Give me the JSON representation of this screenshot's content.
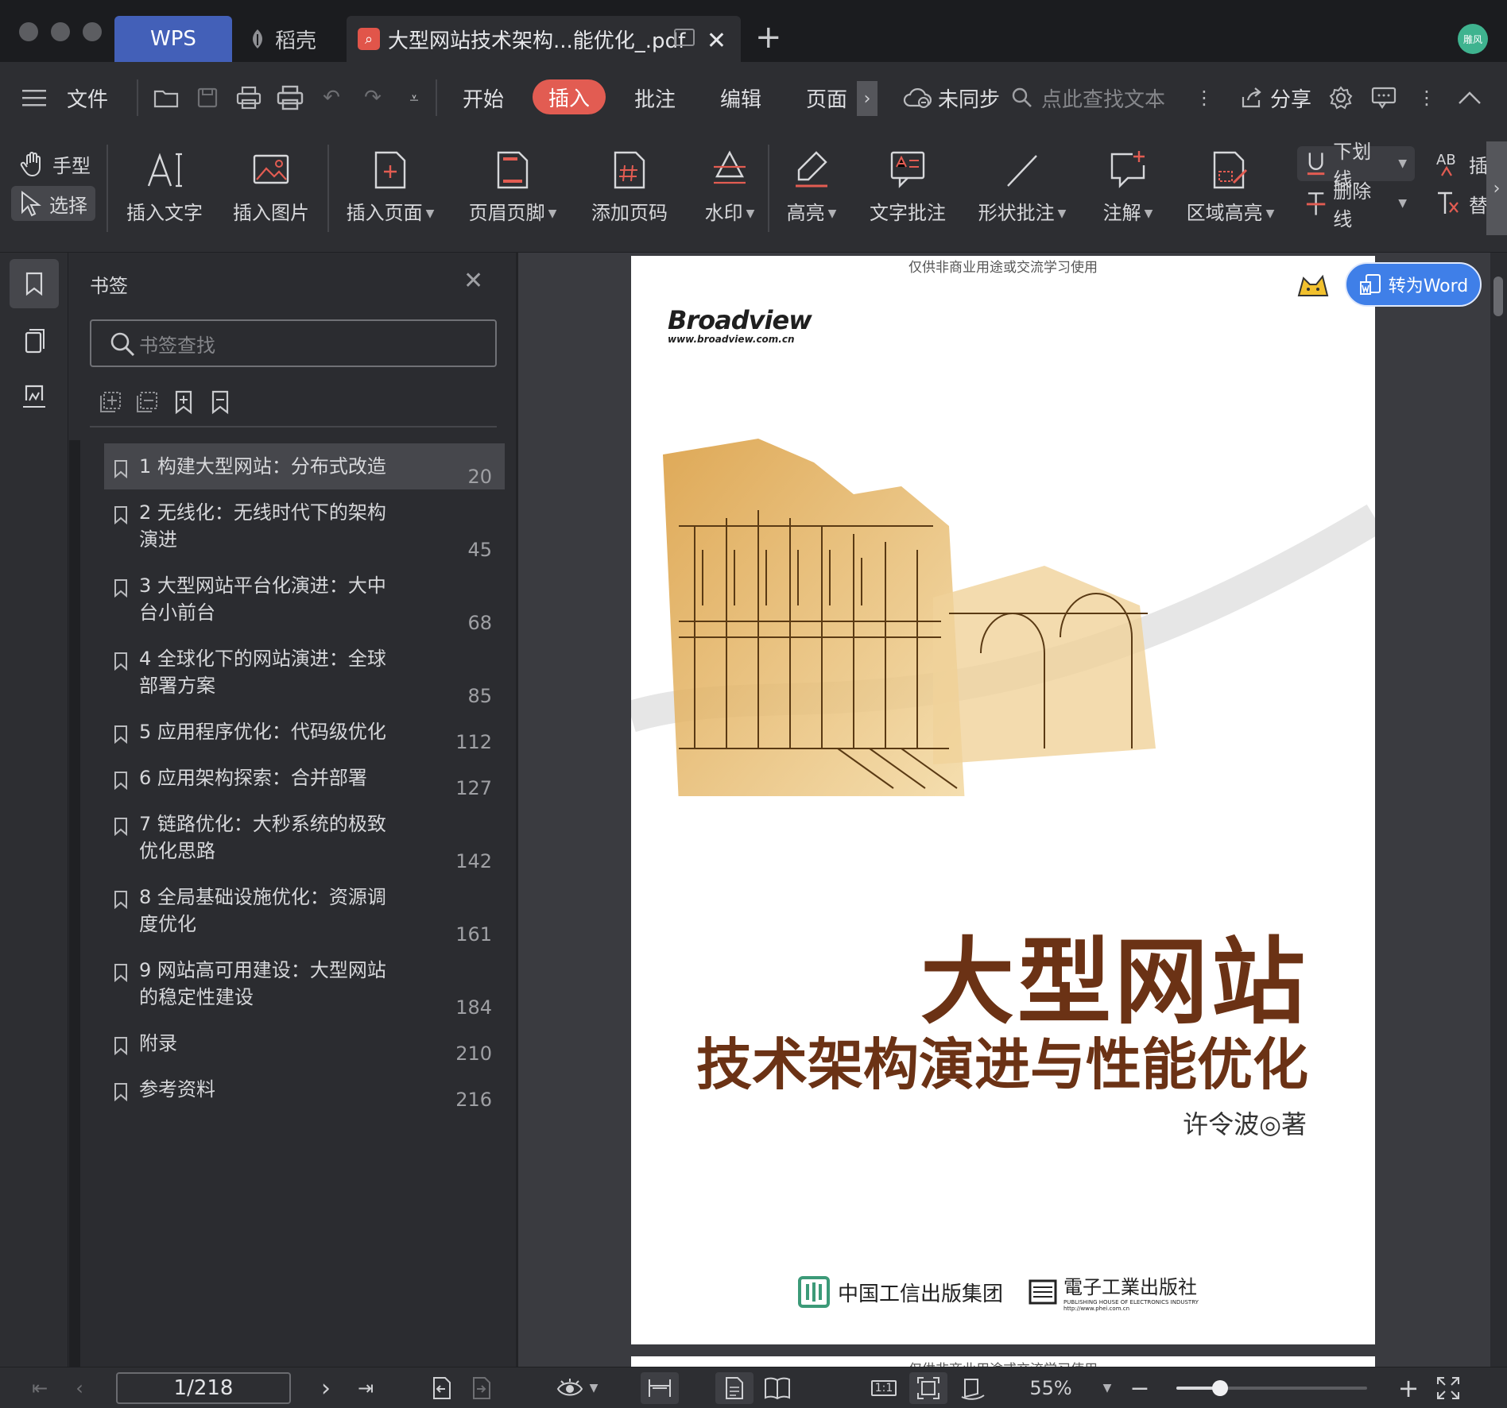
{
  "tabs": {
    "wps": "WPS",
    "docer": "稻壳",
    "pdf": "大型网站技术架构...能优化_.pdf"
  },
  "account": {
    "avatar": "雕风"
  },
  "menubar": {
    "file": "文件",
    "start": "开始",
    "insert": "插入",
    "annotate": "批注",
    "edit": "编辑",
    "page": "页面",
    "sync": "未同步",
    "search_placeholder": "点此查找文本",
    "share": "分享"
  },
  "ribbon": {
    "hand": "手型",
    "select": "选择",
    "insert_text": "插入文字",
    "insert_image": "插入图片",
    "insert_page": "插入页面",
    "header_footer": "页眉页脚",
    "add_page_number": "添加页码",
    "watermark": "水印",
    "highlight": "高亮",
    "text_annotation": "文字批注",
    "shape_annotation": "形状批注",
    "note": "注解",
    "area_highlight": "区域高亮",
    "underline": "下划线",
    "strikethrough": "删除线",
    "insert_short": "插",
    "replace_short": "替"
  },
  "bookmarks": {
    "title": "书签",
    "search_placeholder": "书签查找",
    "items": [
      {
        "label": "1 构建大型网站：分布式改造",
        "page": "20"
      },
      {
        "label": "2 无线化：无线时代下的架构演进",
        "page": "45"
      },
      {
        "label": "3 大型网站平台化演进：大中台小前台",
        "page": "68"
      },
      {
        "label": "4 全球化下的网站演进：全球部署方案",
        "page": "85"
      },
      {
        "label": "5 应用程序优化：代码级优化",
        "page": "112"
      },
      {
        "label": "6 应用架构探索：合并部署",
        "page": "127"
      },
      {
        "label": "7 链路优化：大秒系统的极致优化思路",
        "page": "142"
      },
      {
        "label": "8 全局基础设施优化：资源调度优化",
        "page": "161"
      },
      {
        "label": "9 网站高可用建设：大型网站的稳定性建设",
        "page": "184"
      },
      {
        "label": "附录",
        "page": "210"
      },
      {
        "label": "参考资料",
        "page": "216"
      }
    ]
  },
  "document": {
    "watermark": "仅供非商业用途或交流学习使用",
    "publisher_brand": "Broadview",
    "publisher_url": "www.broadview.com.cn",
    "title": "大型网站",
    "subtitle": "技术架构演进与性能优化",
    "author": "许令波◎著",
    "publisher1": "中国工信出版集团",
    "publisher2": "電子工業出版社",
    "publisher2_en": "PUBLISHING HOUSE OF ELECTRONICS INDUSTRY",
    "publisher2_url": "http://www.phei.com.cn"
  },
  "convert_button": "转为Word",
  "statusbar": {
    "page_indicator": "1/218",
    "zoom": "55%",
    "zoom_fraction": 0.23,
    "fit_label": "1:1"
  },
  "colors": {
    "accent_insert": "#e25c52",
    "wps_tab": "#4360b8",
    "convert_blue": "#3f7fe8",
    "title_brown": "#6b3215"
  }
}
